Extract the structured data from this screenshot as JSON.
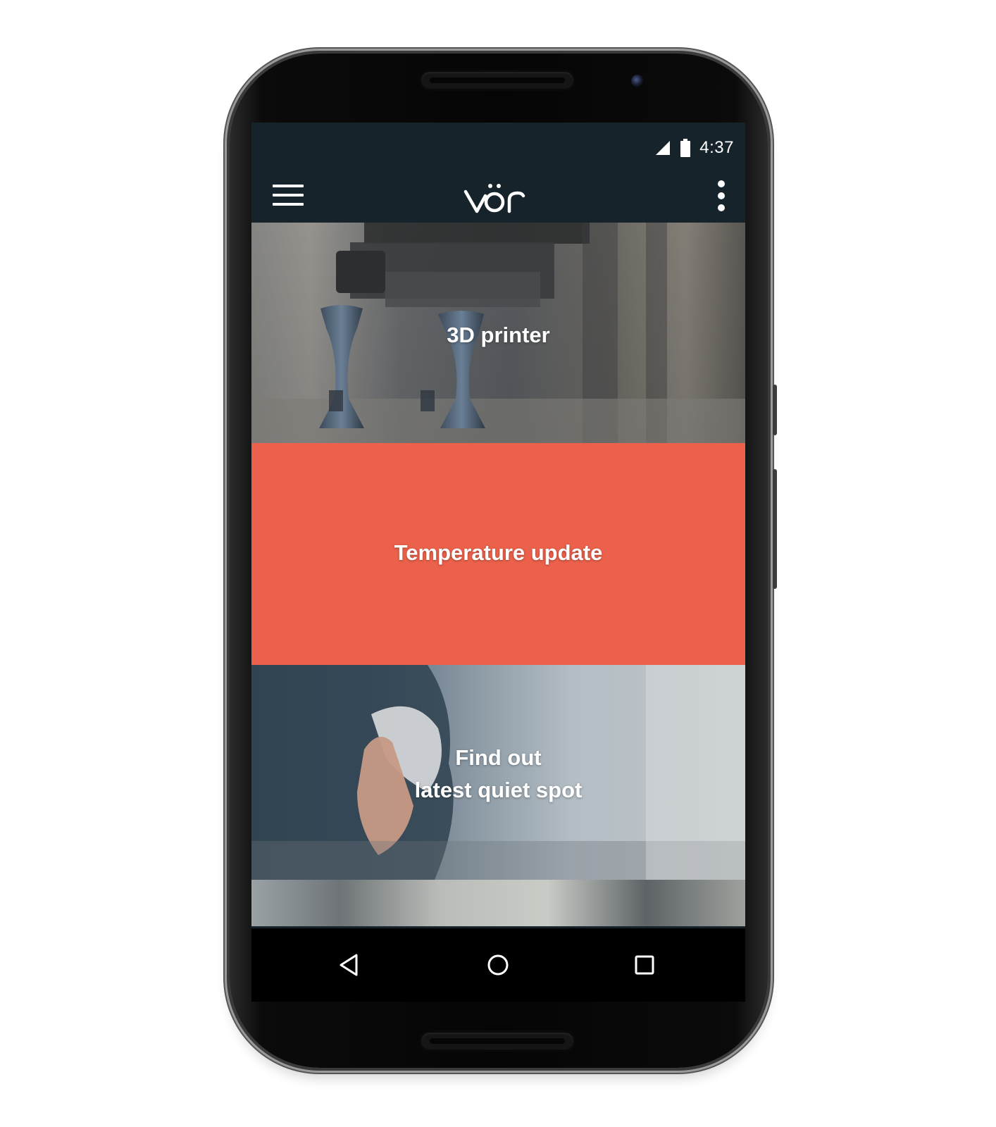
{
  "status_bar": {
    "time": "4:37",
    "signal_icon": "signal-icon",
    "battery_icon": "battery-icon"
  },
  "app_bar": {
    "menu_icon": "hamburger-menu-icon",
    "logo_text": "vör",
    "overflow_icon": "more-vertical-icon"
  },
  "cards": [
    {
      "title": "3D printer"
    },
    {
      "title": "Temperature update",
      "color": "#ec614b"
    },
    {
      "title_line1": "Find out",
      "title_line2": "latest quiet spot"
    }
  ],
  "nav_bar": {
    "back_icon": "back-triangle-icon",
    "home_icon": "home-circle-icon",
    "recents_icon": "recents-square-icon"
  },
  "colors": {
    "app_bar": "#16232b",
    "accent": "#ec614b",
    "nav_bar": "#000000"
  }
}
